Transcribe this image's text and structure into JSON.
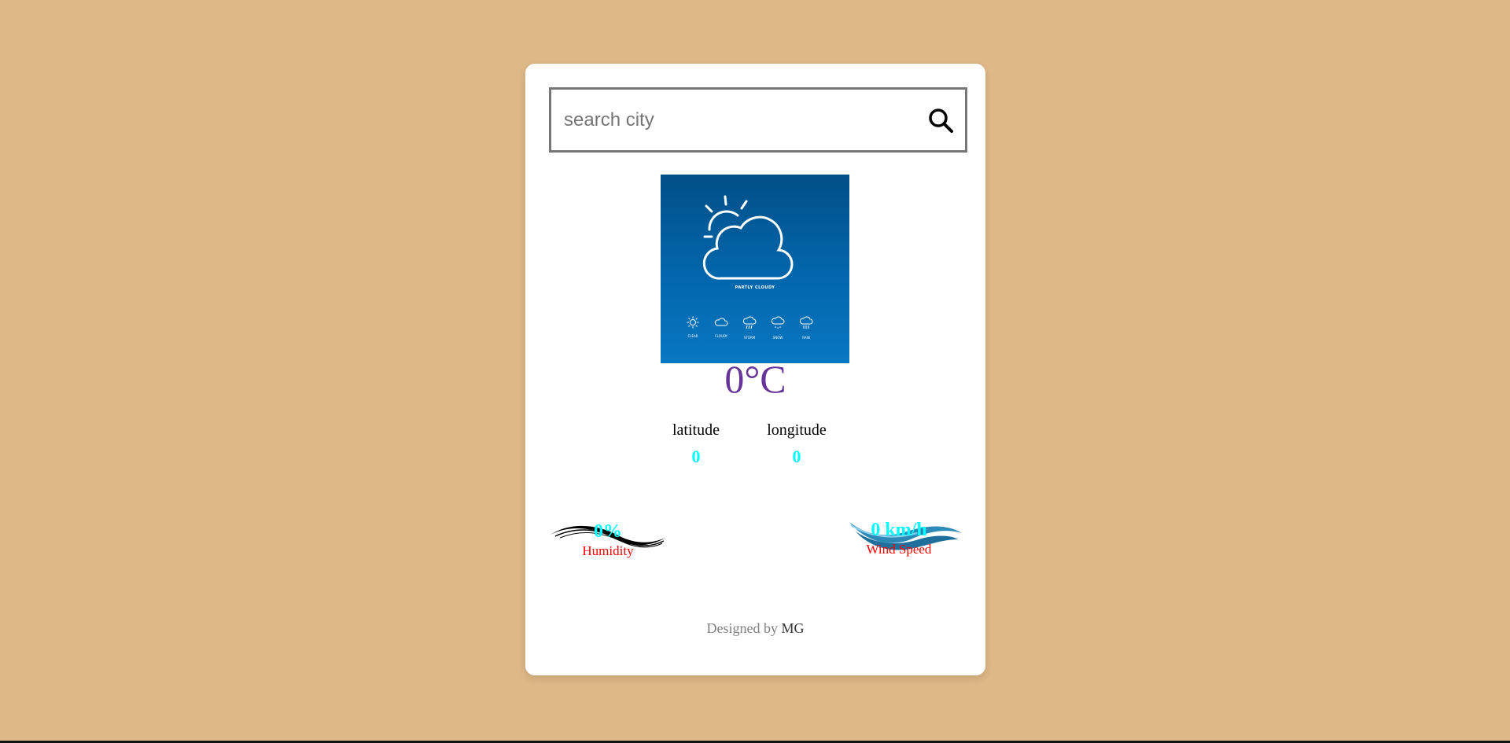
{
  "search": {
    "placeholder": "search city",
    "value": ""
  },
  "weather": {
    "image_caption": "PARTLY CLOUDY",
    "mini_icons": [
      "CLEAR",
      "CLOUDY",
      "STORM",
      "SNOW",
      "RAIN"
    ],
    "temperature": "0°C"
  },
  "coordinates": {
    "latitude_label": "latitude",
    "latitude_value": "0",
    "longitude_label": "longitude",
    "longitude_value": "0"
  },
  "stats": {
    "humidity_value": "0%",
    "humidity_label": "Humidity",
    "wind_value": "0 km/h",
    "wind_label": "Wind Speed"
  },
  "footer": {
    "prefix": "Designed by",
    "author": "MG"
  },
  "colors": {
    "background": "#deb887",
    "card": "#ffffff",
    "temperature": "#663399",
    "value": "#00ffff",
    "stat_label": "#ff0000"
  },
  "icons": {
    "search": "search-icon",
    "humidity": "humidity-wave-icon",
    "wind": "wind-wave-icon"
  }
}
